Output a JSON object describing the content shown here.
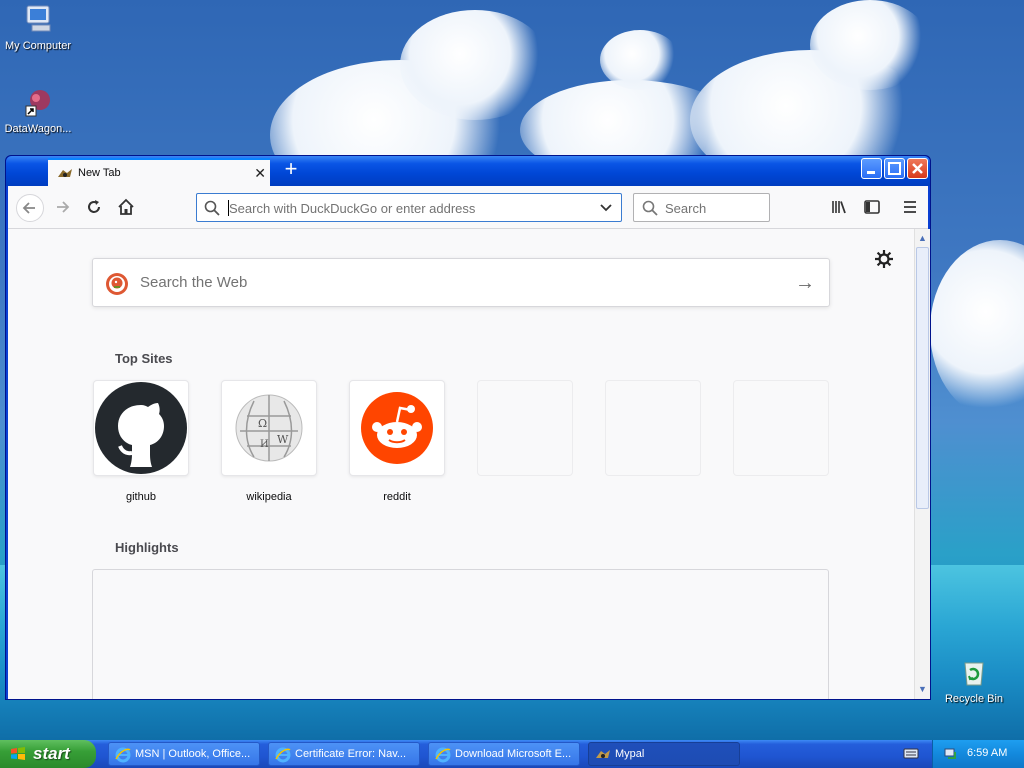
{
  "desktop": {
    "icons": [
      {
        "label": "My Computer",
        "icon": "computer-icon"
      },
      {
        "label": "DataWagon...",
        "icon": "datawagon-shortcut-icon"
      },
      {
        "label": "Recycle Bin",
        "icon": "recycle-bin-icon"
      }
    ]
  },
  "browser": {
    "tab": {
      "title": "New Tab",
      "favicon": "mypal-icon"
    },
    "urlbar": {
      "placeholder": "Search with DuckDuckGo or enter address"
    },
    "searchbox": {
      "placeholder": "Search"
    },
    "content": {
      "web_search_placeholder": "Search the Web",
      "top_sites_heading": "Top Sites",
      "top_sites": [
        {
          "label": "github"
        },
        {
          "label": "wikipedia"
        },
        {
          "label": "reddit"
        }
      ],
      "highlights_heading": "Highlights"
    }
  },
  "taskbar": {
    "start_label": "start",
    "tasks": [
      {
        "label": "MSN | Outlook, Office...",
        "icon": "ie-icon"
      },
      {
        "label": "Certificate Error: Nav...",
        "icon": "ie-icon"
      },
      {
        "label": "Download Microsoft E...",
        "icon": "ie-icon"
      },
      {
        "label": "Mypal",
        "icon": "mypal-icon"
      }
    ],
    "clock": "6:59 AM"
  },
  "colors": {
    "accent": "#0a84ff",
    "xp_blue": "#0a55e6",
    "start_green": "#379f37",
    "reddit": "#ff4500",
    "github": "#24292e"
  }
}
